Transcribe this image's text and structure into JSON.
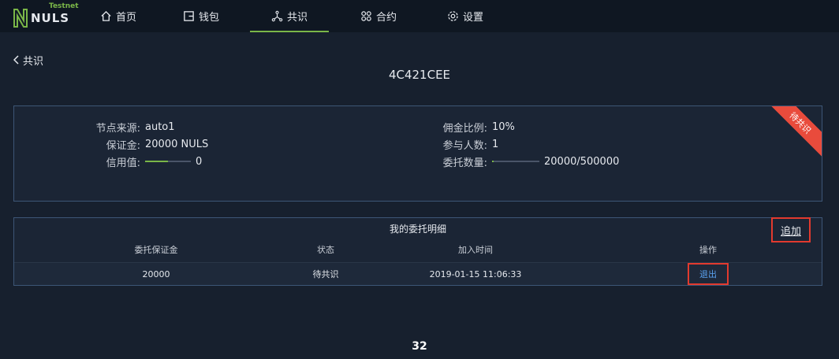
{
  "app": {
    "logo_text": "NULS",
    "logo_badge": "Testnet"
  },
  "nav": {
    "items": [
      {
        "label": "首页",
        "icon": "home-icon"
      },
      {
        "label": "钱包",
        "icon": "wallet-icon"
      },
      {
        "label": "共识",
        "icon": "consensus-icon",
        "active": true
      },
      {
        "label": "合约",
        "icon": "contract-icon"
      },
      {
        "label": "设置",
        "icon": "settings-icon"
      }
    ]
  },
  "back": {
    "label": "共识"
  },
  "title": "4C421CEE",
  "node": {
    "source_label": "节点来源:",
    "source_value": "auto1",
    "deposit_label": "保证金:",
    "deposit_value": "20000 NULS",
    "credit_label": "信用值:",
    "credit_value": "0",
    "commission_label": "佣金比例:",
    "commission_value": "10%",
    "participants_label": "参与人数:",
    "participants_value": "1",
    "entrusted_label": "委托数量:",
    "entrusted_value": "20000/500000",
    "entrusted_fraction": 0.04,
    "credit_fraction": 0.5,
    "status_ribbon": "待共识",
    "ribbon_color": "#e94b3c"
  },
  "delegation": {
    "caption": "我的委托明细",
    "add_label": "追加",
    "headers": [
      "委托保证金",
      "状态",
      "加入时间",
      "操作"
    ],
    "rows": [
      {
        "amount": "20000",
        "status": "待共识",
        "time": "2019-01-15 11:06:33",
        "action": "退出"
      }
    ]
  },
  "page_number": "32",
  "colors": {
    "accent": "#7ab648",
    "highlight_box": "#e23a2e",
    "link": "#5aa2f0"
  }
}
